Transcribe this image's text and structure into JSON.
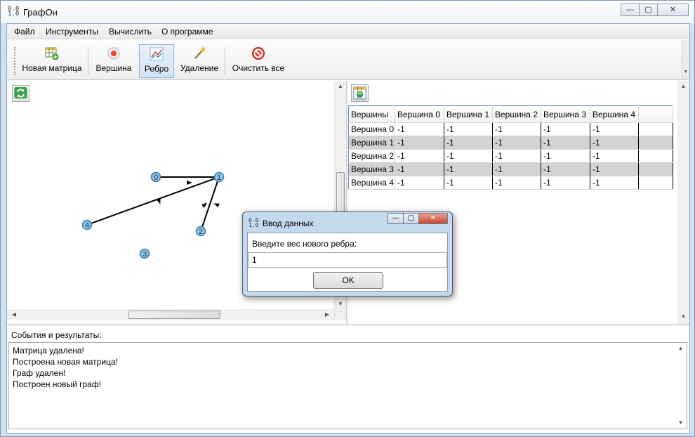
{
  "window": {
    "title": "ГрафОн",
    "icon_text": "0.0\n1.0",
    "controls": {
      "minimize": "—",
      "maximize": "▢",
      "close": "✕"
    }
  },
  "menu": {
    "items": [
      "Файл",
      "Инструменты",
      "Вычислить",
      "О программе"
    ]
  },
  "toolbar": {
    "buttons": [
      {
        "label": "Новая матрица",
        "icon": "table-add-icon",
        "active": false
      },
      {
        "label": "Вершина",
        "icon": "vertex-icon",
        "active": false
      },
      {
        "label": "Ребро",
        "icon": "edge-icon",
        "active": true
      },
      {
        "label": "Удаление",
        "icon": "wand-icon",
        "active": false
      },
      {
        "label": "Очистить все",
        "icon": "clear-all-icon",
        "active": false
      }
    ]
  },
  "graph": {
    "vertices": [
      {
        "label": "0"
      },
      {
        "label": "1"
      },
      {
        "label": "2"
      },
      {
        "label": "3"
      },
      {
        "label": "4"
      }
    ],
    "edges": [
      {
        "from": "0",
        "to": "1"
      },
      {
        "from": "4",
        "to": "1"
      },
      {
        "from": "2",
        "to": "1"
      }
    ]
  },
  "matrix": {
    "headers": [
      "Вершины",
      "Вершина 0",
      "Вершина 1",
      "Вершина 2",
      "Вершина 3",
      "Вершина 4"
    ],
    "rows": [
      {
        "name": "Вершина 0",
        "values": [
          "-1",
          "-1",
          "-1",
          "-1",
          "-1"
        ]
      },
      {
        "name": "Вершина 1",
        "values": [
          "-1",
          "-1",
          "-1",
          "-1",
          "-1"
        ]
      },
      {
        "name": "Вершина 2",
        "values": [
          "-1",
          "-1",
          "-1",
          "-1",
          "-1"
        ]
      },
      {
        "name": "Вершина 3",
        "values": [
          "-1",
          "-1",
          "-1",
          "-1",
          "-1"
        ]
      },
      {
        "name": "Вершина 4",
        "values": [
          "-1",
          "-1",
          "-1",
          "-1",
          "-1"
        ]
      }
    ]
  },
  "events": {
    "label": "События и результаты:",
    "lines": [
      "Матрица удалена!",
      "Построена новая матрица!",
      "Граф удален!",
      "Построен новый граф!"
    ]
  },
  "dialog": {
    "title": "Ввод данных",
    "prompt": "Введите вес нового ребра:",
    "input_value": "1",
    "ok_label": "OK"
  },
  "colors": {
    "vertex_fill": "#8fc3e6",
    "vertex_stroke": "#3a7fb3",
    "alt_row": "#d3d3d3",
    "active_tool": "#d3e3f5"
  }
}
